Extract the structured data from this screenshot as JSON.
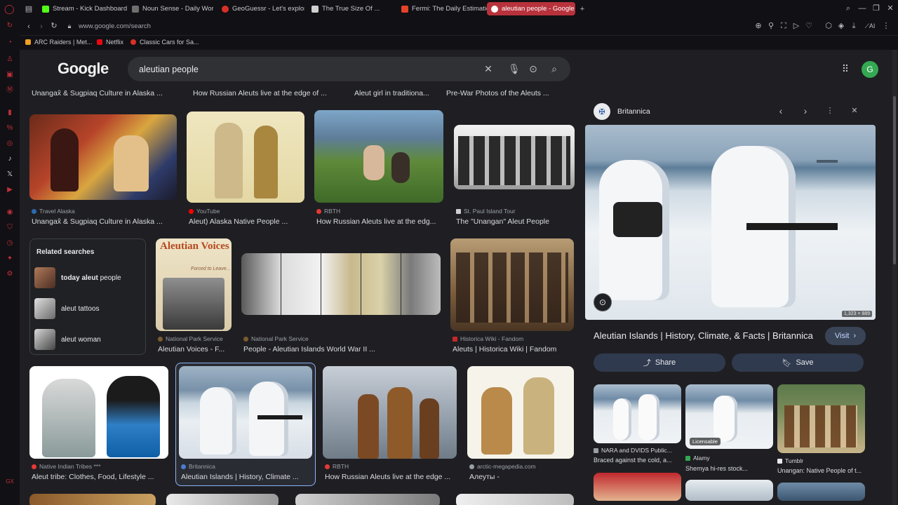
{
  "tabs": [
    {
      "label": "Stream - Kick Dashboard",
      "color": "#53fc18"
    },
    {
      "label": "Noun Sense - Daily Word",
      "color": "#6f6f6f"
    },
    {
      "label": "GeoGuessr - Let's explore",
      "color": "#d93025"
    },
    {
      "label": "The True Size Of ...",
      "color": "#cfcfcf"
    },
    {
      "label": "Fermi: The Daily Estimation",
      "color": "#e24329"
    },
    {
      "label": "aleutian people - Google S",
      "color": "#4285f4"
    }
  ],
  "address": {
    "url": "www.google.com/search"
  },
  "bookmarks": [
    {
      "label": "ARC Raiders | Met...",
      "color": "#f0a020"
    },
    {
      "label": "Netflix",
      "color": "#e50914"
    },
    {
      "label": "Classic Cars for Sa...",
      "color": "#d93025"
    }
  ],
  "google": {
    "logo": "Google",
    "query": "aleutian people",
    "avatar": "G"
  },
  "top_cut_titles": [
    "Unangax̂ & Sugpiaq Culture in Alaska ...",
    "How Russian Aleuts live at the edge of ...",
    "Aleut girl in traditiona...",
    "Pre-War Photos of the Aleuts ..."
  ],
  "row1": [
    {
      "source": "Travel Alaska",
      "title": "Unangax̂ & Sugpiaq Culture in Alaska ...",
      "dot": "#2b6cb0"
    },
    {
      "source": "YouTube",
      "title": "Aleut) Alaska Native People ...",
      "dot": "#ff0000"
    },
    {
      "source": "RBTH",
      "title": "How Russian Aleuts live at the edg...",
      "dot": "#e53935"
    },
    {
      "source": "St. Paul Island Tour",
      "title": "The \"Unangan\" Aleut People",
      "dot": "#cfcfcf"
    }
  ],
  "related": {
    "heading": "Related searches",
    "items": [
      {
        "bold": "today aleut",
        "rest": " people"
      },
      {
        "bold": "",
        "rest": "aleut tattoos"
      },
      {
        "bold": "",
        "rest": "aleut woman"
      }
    ]
  },
  "row2": [
    {
      "source": "National Park Service",
      "title": "Aleutian Voices - F...",
      "dot": "#7a5c2e",
      "book_title": "Aleutian Voices",
      "book_sub": "Forced to Leave..."
    },
    {
      "source": "National Park Service",
      "title": "People - Aleutian Islands World War II ...",
      "dot": "#7a5c2e"
    },
    {
      "source": "Historica Wiki - Fandom",
      "title": "Aleuts | Historica Wiki | Fandom",
      "dot": "#c62828"
    }
  ],
  "row3": [
    {
      "source": "Native Indian Tribes ***",
      "title": "Aleut tribe: Clothes, Food, Lifestyle ...",
      "dot": "#e53935"
    },
    {
      "source": "Britannica",
      "title": "Aleutian Islands | History, Climate ...",
      "dot": "#4a7bd0"
    },
    {
      "source": "RBTH",
      "title": "How Russian Aleuts live at the edge ...",
      "dot": "#e53935"
    },
    {
      "source": "arctic-megapedia.com",
      "title": "Алеуты -",
      "dot": "#9aa0a6"
    }
  ],
  "panel": {
    "source": "Britannica",
    "dimensions": "1,323 × 889",
    "title": "Aleutian Islands | History, Climate, & Facts | Britannica",
    "visit": "Visit",
    "share": "Share",
    "save": "Save",
    "related": [
      {
        "source": "NARA and DVIDS Public...",
        "title": "Braced against the cold, a...",
        "badge": ""
      },
      {
        "source": "Alamy",
        "title": "Shemya hi-res stock...",
        "badge": "Licensable"
      },
      {
        "source": "Tumblr",
        "title": "Unangan: Native People of t...",
        "badge": ""
      }
    ]
  }
}
